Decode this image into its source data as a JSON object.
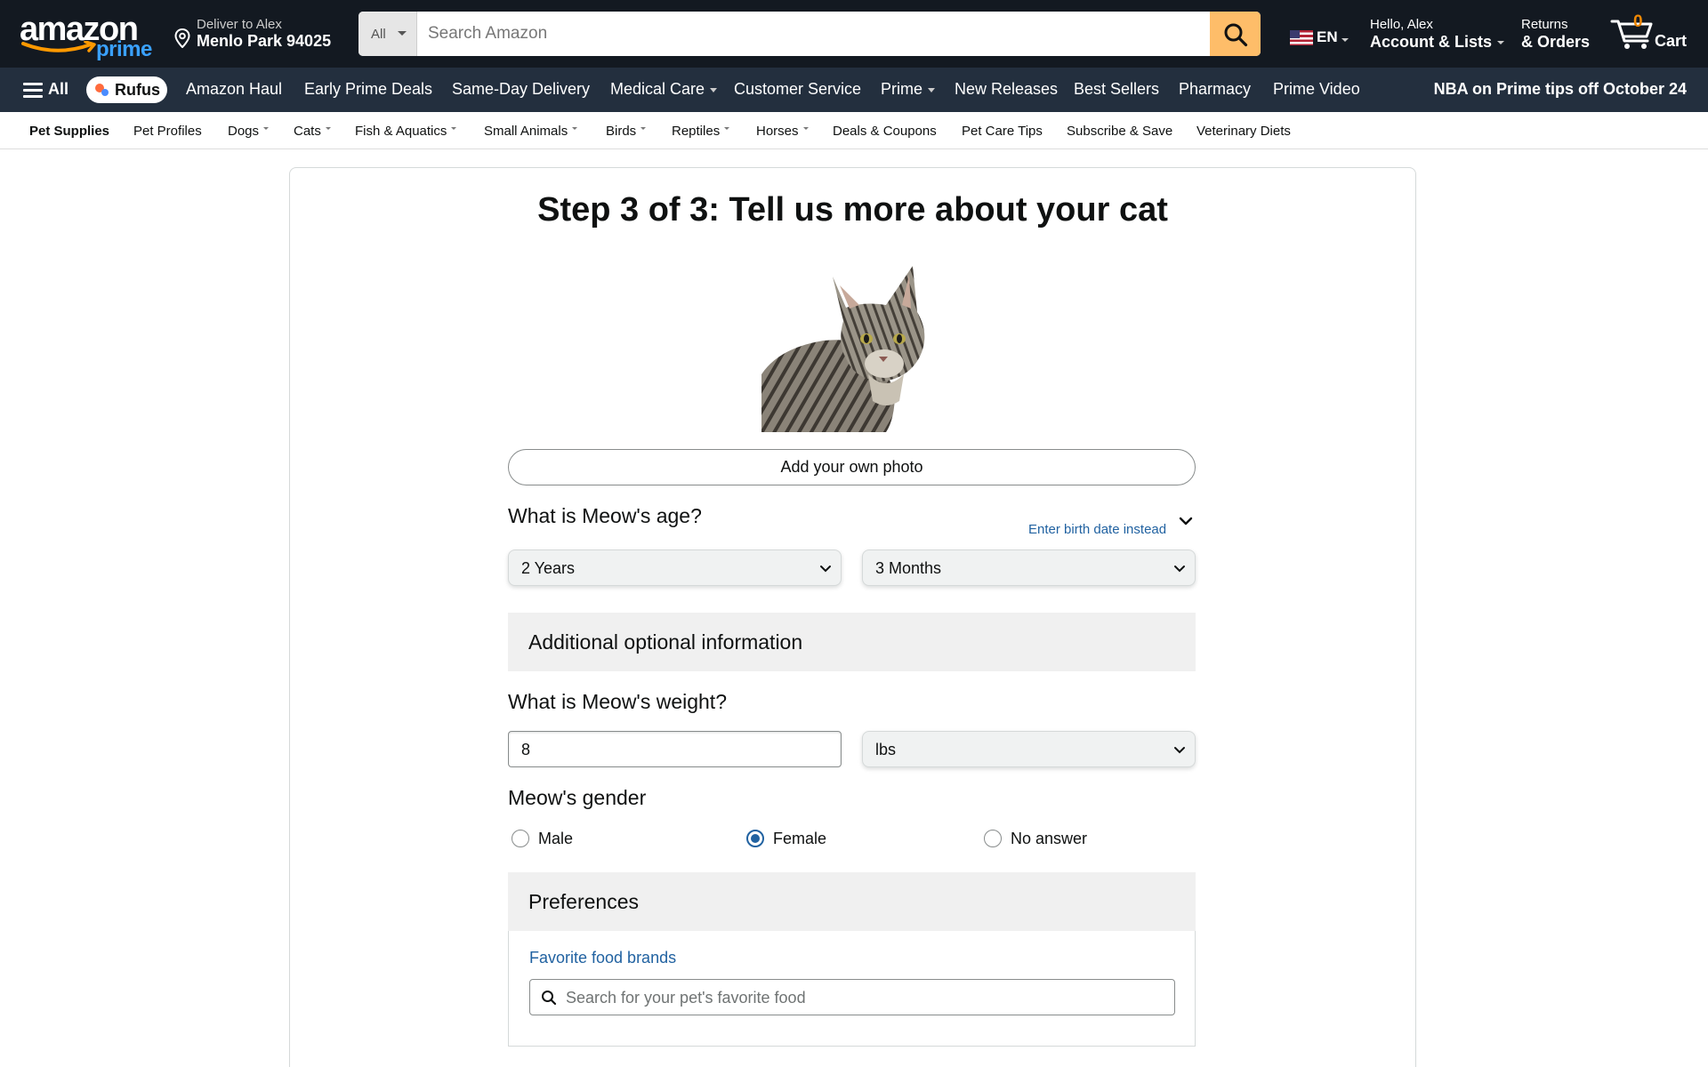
{
  "header": {
    "logo_text": "amazon",
    "logo_prime": "prime",
    "deliver_line1": "Deliver to Alex",
    "deliver_line2": "Menlo Park 94025",
    "search_category": "All",
    "search_placeholder": "Search Amazon",
    "language": "EN",
    "account_line1": "Hello, Alex",
    "account_line2": "Account & Lists",
    "returns_line1": "Returns",
    "returns_line2": "& Orders",
    "cart_count": "0",
    "cart_label": "Cart"
  },
  "main_nav": {
    "all_label": "All",
    "rufus_label": "Rufus",
    "items": [
      "Amazon Haul",
      "Early Prime Deals",
      "Same-Day Delivery",
      "Medical Care",
      "Customer Service",
      "Prime",
      "New Releases",
      "Best Sellers",
      "Pharmacy",
      "Prime Video"
    ],
    "promo": "NBA on Prime tips off October 24"
  },
  "sub_nav": {
    "items": [
      "Pet Supplies",
      "Pet Profiles",
      "Dogs",
      "Cats",
      "Fish & Aquatics",
      "Small Animals",
      "Birds",
      "Reptiles",
      "Horses",
      "Deals & Coupons",
      "Pet Care Tips",
      "Subscribe & Save",
      "Veterinary Diets"
    ]
  },
  "form": {
    "title": "Step 3 of 3: Tell us more about your cat",
    "add_photo_label": "Add your own photo",
    "age_question": "What is Meow's age?",
    "birth_date_link": "Enter birth date instead",
    "age_years": "2 Years",
    "age_months": "3 Months",
    "optional_header": "Additional optional information",
    "weight_question": "What is Meow's weight?",
    "weight_value": "8",
    "weight_unit": "lbs",
    "gender_question": "Meow's gender",
    "gender_options": [
      "Male",
      "Female",
      "No answer"
    ],
    "gender_selected": "Female",
    "preferences_header": "Preferences",
    "favorite_food_link": "Favorite food brands",
    "food_search_placeholder": "Search for your pet's favorite food"
  },
  "colors": {
    "nav_dark": "#131921",
    "nav_secondary": "#232f3e",
    "search_button": "#febd69",
    "link_blue": "#2162a1",
    "cart_count": "#f08804"
  },
  "icons": [
    "location-pin-icon",
    "search-icon",
    "us-flag-icon",
    "cart-icon",
    "hamburger-menu-icon",
    "chevron-down-icon"
  ]
}
